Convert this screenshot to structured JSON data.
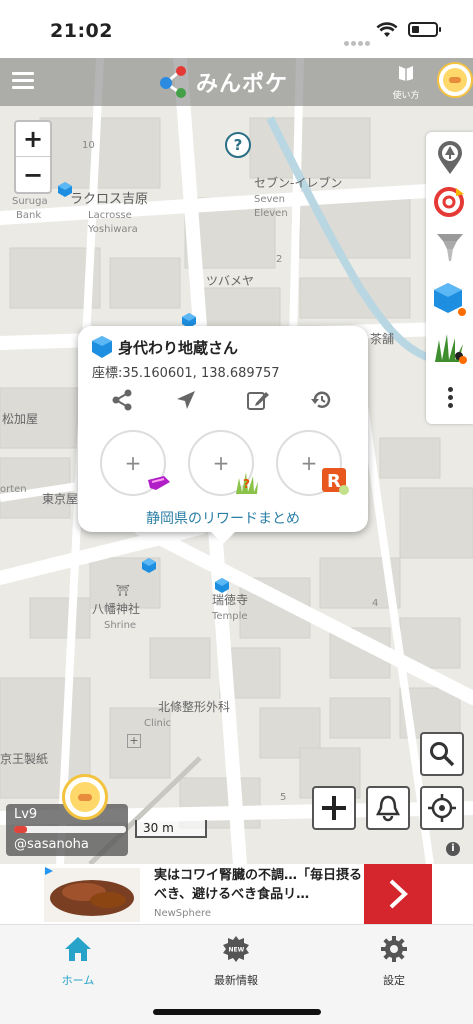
{
  "status_bar": {
    "time": "21:02"
  },
  "header": {
    "app_name": "みんポケ",
    "guide_label": "使い方"
  },
  "map": {
    "zoom_in": "+",
    "zoom_out": "−",
    "help": "?",
    "labels": [
      {
        "text": "10",
        "cls": "en"
      },
      {
        "text": "ラクロス吉原",
        "cls": "big"
      },
      {
        "text": "Suruga",
        "cls": "en"
      },
      {
        "text": "Bank",
        "cls": "en"
      },
      {
        "text": "Lacrosse",
        "cls": "en"
      },
      {
        "text": "Yoshiwara",
        "cls": "en"
      },
      {
        "text": "セブン-イレブン",
        "cls": ""
      },
      {
        "text": "Seven",
        "cls": "en"
      },
      {
        "text": "Eleven",
        "cls": "en"
      },
      {
        "text": "ツバメヤ",
        "cls": ""
      },
      {
        "text": "2",
        "cls": "en"
      },
      {
        "text": "茶舗",
        "cls": ""
      },
      {
        "text": "松加屋",
        "cls": ""
      },
      {
        "text": "東京屋",
        "cls": ""
      },
      {
        "text": "八幡神社",
        "cls": ""
      },
      {
        "text": "Shrine",
        "cls": "en"
      },
      {
        "text": "瑞徳寺",
        "cls": ""
      },
      {
        "text": "Temple",
        "cls": "en"
      },
      {
        "text": "北條整形外科",
        "cls": ""
      },
      {
        "text": "Clinic",
        "cls": "en"
      },
      {
        "text": "京王製紙",
        "cls": ""
      },
      {
        "text": "4",
        "cls": "en"
      },
      {
        "text": "5",
        "cls": "en"
      },
      {
        "text": "orten",
        "cls": "en"
      }
    ],
    "scale": "30 m"
  },
  "popup": {
    "title": "身代わり地蔵さん",
    "coordinates": "座標:35.160601, 138.689757",
    "slot_plus": "+",
    "link": "静岡県のリワードまとめ"
  },
  "user": {
    "level": "Lv9",
    "level_progress": 0.12,
    "name": "@sasanoha"
  },
  "ad": {
    "text": "実はコワイ腎臓の不調…「毎日摂るべき、避けるべき食品リ…",
    "source": "NewSphere"
  },
  "bottom_nav": [
    {
      "label": "ホーム",
      "icon": "home-icon",
      "active": true
    },
    {
      "label": "最新情報",
      "icon": "news-icon",
      "active": false
    },
    {
      "label": "設定",
      "icon": "gear-icon",
      "active": false
    }
  ],
  "colors": {
    "accent": "#27a3c9",
    "cube": "#1e8fe0",
    "ad_button": "#d4262c",
    "link": "#2a7ea6"
  }
}
